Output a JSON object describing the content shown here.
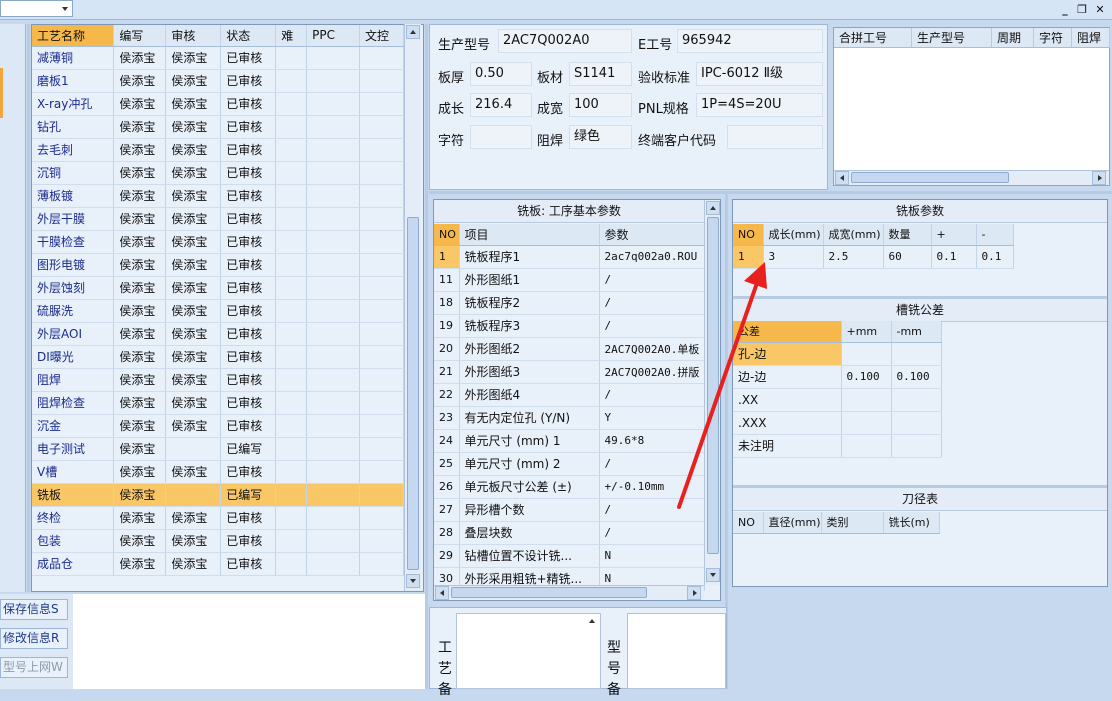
{
  "toolbar": {
    "combo_value": ""
  },
  "window_controls": {
    "minimize": "_",
    "restore": "❐",
    "close": "✕"
  },
  "process_grid": {
    "columns": [
      "工艺名称",
      "编写",
      "审核",
      "状态",
      "难",
      "PPC",
      "文控"
    ],
    "rows": [
      {
        "name": "减薄铜",
        "writer": "侯添宝",
        "reviewer": "侯添宝",
        "status": "已审核"
      },
      {
        "name": "磨板1",
        "writer": "侯添宝",
        "reviewer": "侯添宝",
        "status": "已审核"
      },
      {
        "name": "X-ray冲孔",
        "writer": "侯添宝",
        "reviewer": "侯添宝",
        "status": "已审核"
      },
      {
        "name": "钻孔",
        "writer": "侯添宝",
        "reviewer": "侯添宝",
        "status": "已审核"
      },
      {
        "name": "去毛刺",
        "writer": "侯添宝",
        "reviewer": "侯添宝",
        "status": "已审核"
      },
      {
        "name": "沉铜",
        "writer": "侯添宝",
        "reviewer": "侯添宝",
        "status": "已审核"
      },
      {
        "name": "薄板镀",
        "writer": "侯添宝",
        "reviewer": "侯添宝",
        "status": "已审核"
      },
      {
        "name": "外层干膜",
        "writer": "侯添宝",
        "reviewer": "侯添宝",
        "status": "已审核"
      },
      {
        "name": "干膜检查",
        "writer": "侯添宝",
        "reviewer": "侯添宝",
        "status": "已审核"
      },
      {
        "name": "图形电镀",
        "writer": "侯添宝",
        "reviewer": "侯添宝",
        "status": "已审核"
      },
      {
        "name": "外层蚀刻",
        "writer": "侯添宝",
        "reviewer": "侯添宝",
        "status": "已审核"
      },
      {
        "name": "硫脲洗",
        "writer": "侯添宝",
        "reviewer": "侯添宝",
        "status": "已审核"
      },
      {
        "name": "外层AOI",
        "writer": "侯添宝",
        "reviewer": "侯添宝",
        "status": "已审核"
      },
      {
        "name": "DI曝光",
        "writer": "侯添宝",
        "reviewer": "侯添宝",
        "status": "已审核"
      },
      {
        "name": "阻焊",
        "writer": "侯添宝",
        "reviewer": "侯添宝",
        "status": "已审核"
      },
      {
        "name": "阻焊检查",
        "writer": "侯添宝",
        "reviewer": "侯添宝",
        "status": "已审核"
      },
      {
        "name": "沉金",
        "writer": "侯添宝",
        "reviewer": "侯添宝",
        "status": "已审核"
      },
      {
        "name": "电子测试",
        "writer": "侯添宝",
        "reviewer": "",
        "status": "已编写"
      },
      {
        "name": "V槽",
        "writer": "侯添宝",
        "reviewer": "侯添宝",
        "status": "已审核"
      },
      {
        "name": "铣板",
        "writer": "侯添宝",
        "reviewer": "",
        "status": "已编写",
        "active": true
      },
      {
        "name": "终检",
        "writer": "侯添宝",
        "reviewer": "侯添宝",
        "status": "已审核"
      },
      {
        "name": "包装",
        "writer": "侯添宝",
        "reviewer": "侯添宝",
        "status": "已审核"
      },
      {
        "name": "成品仓",
        "writer": "侯添宝",
        "reviewer": "侯添宝",
        "status": "已审核"
      }
    ]
  },
  "left_buttons": {
    "save": "保存信息S",
    "modify": "修改信息R",
    "upload": "型号上网W"
  },
  "info": {
    "model_label": "生产型号",
    "model_value": "2AC7Q002A0",
    "eno_label": "E工号",
    "eno_value": "965942",
    "thickness_label": "板厚",
    "thickness_value": "0.50",
    "material_label": "板材",
    "material_value": "S1141",
    "standard_label": "验收标准",
    "standard_value": "IPC-6012 Ⅱ级",
    "length_label": "成长",
    "length_value": "216.4",
    "width_label": "成宽",
    "width_value": "100",
    "pnl_label": "PNL规格",
    "pnl_value": "1P=4S=20U",
    "char_label": "字符",
    "char_value": "",
    "mask_label": "阻焊",
    "mask_value": "绿色",
    "customer_label": "终端客户代码",
    "customer_value": ""
  },
  "combined_table": {
    "columns": [
      "合拼工号",
      "生产型号",
      "周期",
      "字符",
      "阻焊"
    ]
  },
  "mill_basic": {
    "title": "铣板: 工序基本参数",
    "columns": [
      "NO",
      "项目",
      "参数"
    ],
    "rows": [
      {
        "no": "1",
        "item": "铣板程序1",
        "param": "2ac7q002a0.ROU",
        "active": true
      },
      {
        "no": "11",
        "item": "外形图纸1",
        "param": "/"
      },
      {
        "no": "18",
        "item": "铣板程序2",
        "param": "/"
      },
      {
        "no": "19",
        "item": "铣板程序3",
        "param": "/"
      },
      {
        "no": "20",
        "item": "外形图纸2",
        "param": "2AC7Q002A0.单板"
      },
      {
        "no": "21",
        "item": "外形图纸3",
        "param": "2AC7Q002A0.拼版"
      },
      {
        "no": "22",
        "item": "外形图纸4",
        "param": "/"
      },
      {
        "no": "23",
        "item": "有无内定位孔 (Y/N)",
        "param": "Y"
      },
      {
        "no": "24",
        "item": "单元尺寸 (mm) 1",
        "param": "49.6*8"
      },
      {
        "no": "25",
        "item": "单元尺寸 (mm) 2",
        "param": "/"
      },
      {
        "no": "26",
        "item": "单元板尺寸公差 (±)",
        "param": "+/-0.10mm"
      },
      {
        "no": "27",
        "item": "异形槽个数",
        "param": "/"
      },
      {
        "no": "28",
        "item": "叠层块数",
        "param": "/"
      },
      {
        "no": "29",
        "item": "钻槽位置不设计铣...",
        "param": "N"
      },
      {
        "no": "30",
        "item": "外形采用粗铣+精铣...",
        "param": "N"
      }
    ]
  },
  "mill_params": {
    "title": "铣板参数",
    "columns": [
      "NO",
      "成长(mm)",
      "成宽(mm)",
      "数量",
      "+",
      "-"
    ],
    "rows": [
      {
        "no": "1",
        "length": "3",
        "width": "2.5",
        "qty": "60",
        "plus": "0.1",
        "minus": "0.1"
      }
    ]
  },
  "slot_tolerance": {
    "title": "槽铣公差",
    "columns": [
      "公差",
      "+mm",
      "-mm"
    ],
    "rows": [
      {
        "name": "孔-边",
        "plus": "",
        "minus": ""
      },
      {
        "name": "边-边",
        "plus": "0.100",
        "minus": "0.100"
      },
      {
        "name": ".XX",
        "plus": "",
        "minus": ""
      },
      {
        "name": ".XXX",
        "plus": "",
        "minus": ""
      },
      {
        "name": "未注明",
        "plus": "",
        "minus": ""
      }
    ]
  },
  "tool_table": {
    "title": "刀径表",
    "columns": [
      "NO",
      "直径(mm)",
      "类别",
      "铣长(m)"
    ]
  },
  "memo": {
    "process_label": "工艺备",
    "model_label": "型号备"
  },
  "annotation": {
    "arrow_color": "#e8211f"
  }
}
